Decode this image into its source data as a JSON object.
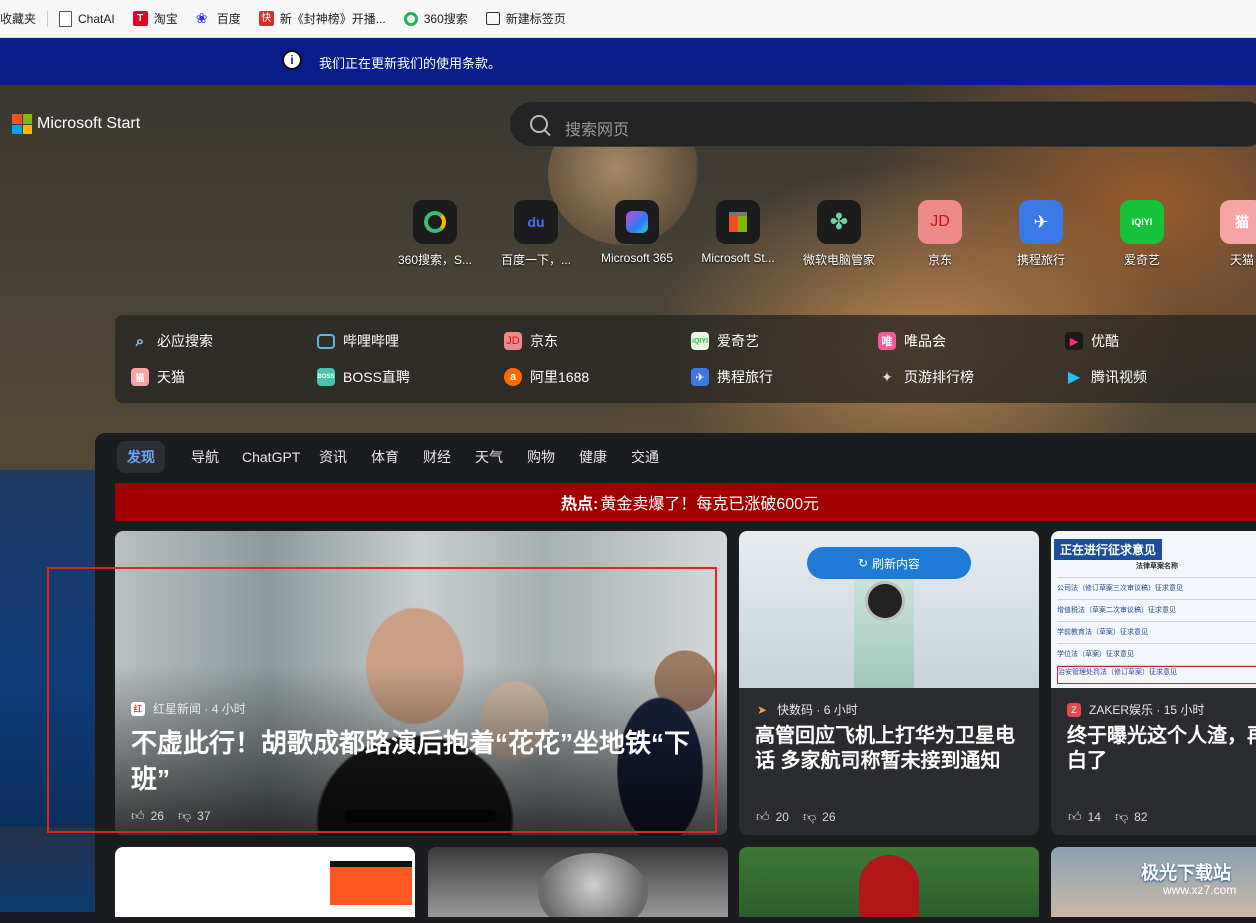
{
  "bookmarks": [
    {
      "label": "收藏夹"
    },
    {
      "label": "ChatAI"
    },
    {
      "label": "淘宝"
    },
    {
      "label": "百度"
    },
    {
      "label": "新《封神榜》开播..."
    },
    {
      "label": "360搜索"
    },
    {
      "label": "新建标签页"
    }
  ],
  "notice": {
    "text": "我们正在更新我们的使用条款。"
  },
  "brand": {
    "name": "Microsoft Start"
  },
  "search": {
    "placeholder": "搜索网页"
  },
  "top_sites": [
    {
      "label": "360搜索，S...",
      "glyph": "◯"
    },
    {
      "label": "百度一下，...",
      "glyph": "du"
    },
    {
      "label": "Microsoft 365",
      "glyph": "◆"
    },
    {
      "label": "Microsoft St...",
      "glyph": "▦"
    },
    {
      "label": "微软电脑管家",
      "glyph": "✤"
    },
    {
      "label": "京东",
      "glyph": "JD"
    },
    {
      "label": "携程旅行",
      "glyph": "✈"
    },
    {
      "label": "爱奇艺",
      "glyph": "iQIYI"
    },
    {
      "label": "天猫",
      "glyph": "猫"
    }
  ],
  "quick_links": [
    {
      "label": "必应搜索",
      "glyph": "🔍"
    },
    {
      "label": "哔哩哔哩",
      "glyph": "📺"
    },
    {
      "label": "京东",
      "glyph": "JD"
    },
    {
      "label": "爱奇艺",
      "glyph": "iQ"
    },
    {
      "label": "唯品会",
      "glyph": "唯"
    },
    {
      "label": "优酷",
      "glyph": "▶"
    },
    {
      "label": "天猫",
      "glyph": "猫"
    },
    {
      "label": "BOSS直聘",
      "glyph": "B"
    },
    {
      "label": "阿里1688",
      "glyph": "a"
    },
    {
      "label": "携程旅行",
      "glyph": "✈"
    },
    {
      "label": "页游排行榜",
      "glyph": "🎮"
    },
    {
      "label": "腾讯视频",
      "glyph": "▶"
    }
  ],
  "tabs": [
    "发现",
    "导航",
    "ChatGPT",
    "资讯",
    "体育",
    "财经",
    "天气",
    "购物",
    "健康",
    "交通"
  ],
  "hot": {
    "prefix": "热点:",
    "text": "黄金卖爆了！每克已涨破600元"
  },
  "refresh": {
    "label": "刷新内容"
  },
  "cards": [
    {
      "source": "红星新闻",
      "time": "4 小时",
      "title": "不虚此行！胡歌成都路演后抱着“花花”坐地铁“下班”",
      "likes": "26",
      "dislikes": "37"
    },
    {
      "source": "快数码",
      "time": "6 小时",
      "title": "高管回应飞机上打华为卫星电话 多家航司称暂未接到通知",
      "likes": "20",
      "dislikes": "26"
    },
    {
      "source": "ZAKER娱乐",
      "time": "15 小时",
      "title": "终于曝光这个人渣，再白了",
      "likes": "14",
      "dislikes": "82"
    }
  ],
  "card3_image": {
    "banner": "正在进行征求意见",
    "header": "法律草案名称",
    "rows": [
      "公司法（修订草案三次审议稿）征求意见",
      "增值税法（草案二次审议稿）征求意见",
      "学前教育法（草案）征求意见",
      "学位法（草案）征求意见",
      "治安管理处罚法（修订草案）征求意见"
    ]
  },
  "card_bottom_image": {
    "watermark": "极光下载站",
    "watermark_sub": "www.xz7.com"
  },
  "colors": {
    "notice_bg": "#0a1d8c",
    "hot_bg": "#a00000",
    "accent": "#6aa7ff",
    "highlight_box": "#e0261a"
  }
}
